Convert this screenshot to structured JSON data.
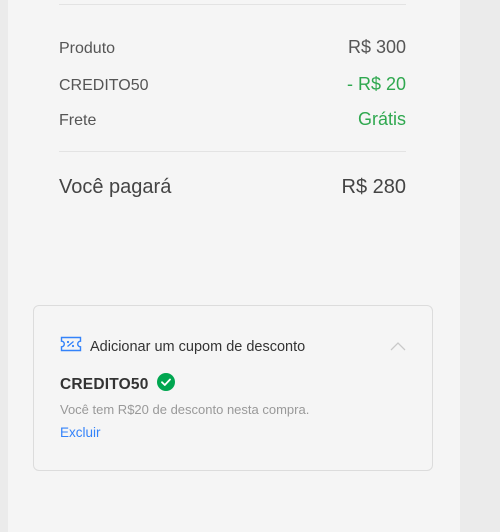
{
  "summary": {
    "product_label": "Produto",
    "product_value": "R$ 300",
    "coupon_label": "CREDITO50",
    "coupon_value": "- R$ 20",
    "shipping_label": "Frete",
    "shipping_value": "Grátis",
    "total_label": "Você pagará",
    "total_value": "R$ 280"
  },
  "coupon_box": {
    "title": "Adicionar um cupom de desconto",
    "code": "CREDITO50",
    "description": "Você tem R$20 de desconto nesta compra.",
    "remove_label": "Excluir"
  },
  "colors": {
    "accent_green": "#2fa84f",
    "link_blue": "#3483fa",
    "check_green": "#00a650"
  },
  "icons": [
    "coupon-ticket-icon",
    "chevron-up-icon",
    "check-circle-icon"
  ]
}
